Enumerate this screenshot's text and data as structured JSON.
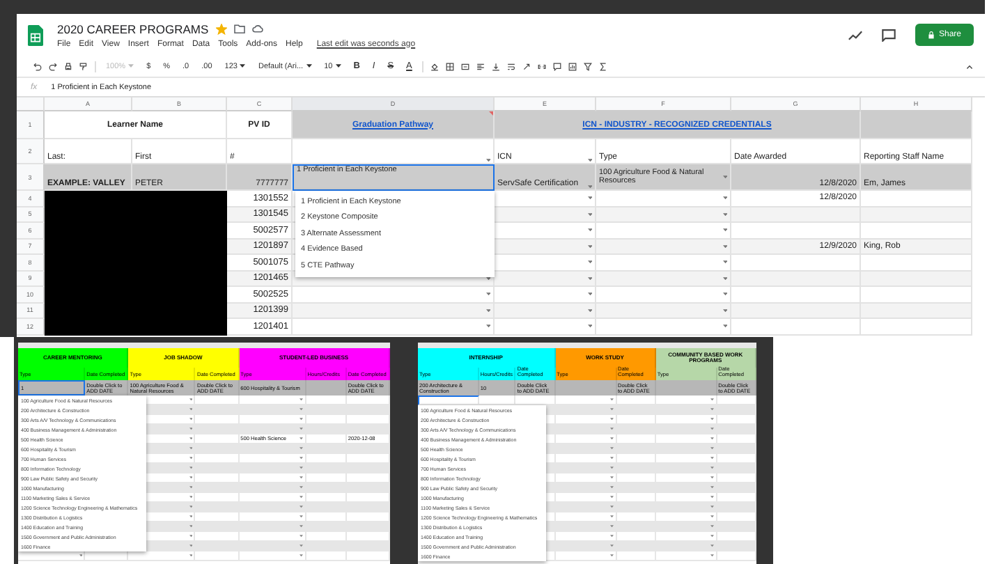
{
  "document": {
    "title": "2020 CAREER PROGRAMS",
    "starred": true,
    "menu": [
      "File",
      "Edit",
      "View",
      "Insert",
      "Format",
      "Data",
      "Tools",
      "Add-ons",
      "Help"
    ],
    "last_edit": "Last edit was seconds ago",
    "share": "Share"
  },
  "toolbar": {
    "items": [
      {
        "kind": "select",
        "label": "100%",
        "disabled": true
      },
      {
        "kind": "button",
        "label": "$",
        "disabled": false
      },
      {
        "kind": "button",
        "label": "%",
        "disabled": false
      },
      {
        "kind": "button",
        "label": ".0",
        "disabled": false
      },
      {
        "kind": "button",
        "label": ".00",
        "disabled": false
      },
      {
        "kind": "select",
        "label": "123",
        "disabled": false
      },
      {
        "kind": "select",
        "label": "Default (Ari...",
        "disabled": false
      },
      {
        "kind": "select",
        "label": "10",
        "disabled": false
      },
      {
        "kind": "bold",
        "label": "B",
        "disabled": false
      },
      {
        "kind": "italic",
        "label": "I",
        "disabled": false
      },
      {
        "kind": "strike",
        "label": "S",
        "disabled": false
      },
      {
        "kind": "textcolor",
        "label": "A",
        "disabled": false
      }
    ]
  },
  "formula_bar": {
    "label": "fx",
    "value": "1 Proficient in Each Keystone"
  },
  "sheet": {
    "columns": [
      "A",
      "B",
      "C",
      "D",
      "E",
      "F",
      "G",
      "H"
    ],
    "heading_row": {
      "number": "1",
      "learner_name": "Learner Name",
      "pv_id": "PV ID",
      "graduation_pathway": "Graduation Pathway",
      "icn": "ICN - INDUSTRY - RECOGNIZED CREDENTIALS"
    },
    "label_row": {
      "number": "2",
      "last": "Last:",
      "first": "First",
      "pv_id": "#",
      "icn": "ICN",
      "type": "Type",
      "date": "Date Awarded",
      "staff": "Reporting Staff Name"
    },
    "example_row": {
      "number": "3",
      "last": "EXAMPLE: VALLEY",
      "first": "PETER",
      "pv_id": "7777777",
      "pathway": "1 Proficient in Each Keystone",
      "icn": "ServSafe Certification",
      "type": "100 Agriculture Food & Natural Resources",
      "date": "12/8/2020",
      "staff": "Em, James"
    },
    "rows": [
      {
        "number": "4",
        "redacted": true,
        "pv_id": "1301552",
        "date": "12/8/2020"
      },
      {
        "number": "5",
        "redacted": true,
        "pv_id": "1301545"
      },
      {
        "number": "6",
        "redacted": true,
        "pv_id": "5002577"
      },
      {
        "number": "7",
        "redacted": true,
        "pv_id": "1201897",
        "date": "12/9/2020",
        "staff": "King, Rob"
      },
      {
        "number": "8",
        "redacted": true,
        "pv_id": "5001075"
      },
      {
        "number": "9",
        "redacted": true,
        "pv_id": "1201465"
      },
      {
        "number": "10",
        "redacted": true,
        "pv_id": "5002525"
      },
      {
        "number": "11",
        "redacted": true,
        "pv_id": "1201399"
      },
      {
        "number": "12",
        "redacted": true,
        "pv_id": "1201401"
      }
    ],
    "dropdown": {
      "options": [
        "1 Proficient in Each Keystone",
        "2 Keystone Composite",
        "3 Alternate Assessment",
        "4 Evidence Based",
        "5 CTE Pathway"
      ]
    }
  },
  "panels": [
    {
      "kind": "cell_editor",
      "groups": [
        {
          "title": "CAREER MENTORING",
          "color": "#00ff00",
          "columns": [
            {
              "label": "Type",
              "kind": "type",
              "example": "1"
            },
            {
              "label": "Date Completed",
              "kind": "date",
              "example": "Double Click to ADD DATE"
            }
          ]
        },
        {
          "title": "JOB SHADOW",
          "color": "#ffff00",
          "columns": [
            {
              "label": "Type",
              "kind": "type",
              "example": "100 Agriculture Food & Natural Resources"
            },
            {
              "label": "Date Completed",
              "kind": "date",
              "example": "Double Click to ADD DATE"
            }
          ]
        },
        {
          "title": "STUDENT-LED BUSINESS",
          "color": "#ff00ff",
          "columns": [
            {
              "label": "Type",
              "kind": "type",
              "example": "600 Hospitality & Tourism"
            },
            {
              "label": "Hours/Credits",
              "kind": "hours"
            },
            {
              "label": "Date Completed",
              "kind": "date",
              "example": "Double Click to ADD DATE"
            }
          ]
        }
      ],
      "body_rows": [
        {
          "shaded": false
        },
        {
          "shaded": true
        },
        {
          "shaded": false
        },
        {
          "shaded": true
        },
        {
          "shaded": false,
          "type_3": "500 Health Science",
          "date_3": "2020-12-08"
        },
        {
          "shaded": true
        },
        {
          "shaded": false
        },
        {
          "shaded": true
        },
        {
          "shaded": false
        },
        {
          "shaded": true
        },
        {
          "shaded": false
        },
        {
          "shaded": true
        },
        {
          "shaded": false
        },
        {
          "shaded": true
        },
        {
          "shaded": false
        },
        {
          "shaded": true
        },
        {
          "shaded": false
        }
      ],
      "options": [
        "100 Agriculture Food & Natural Resources",
        "200 Architecture & Construction",
        "300 Arts A/V Technology & Communications",
        "400 Business Management & Administration",
        "500 Health Science",
        "600 Hospitality & Tourism",
        "700 Human Services",
        "800 Information Technology",
        "900 Law Public Safety and Security",
        "1000 Manufacturing",
        "1100 Marketing Sales & Service",
        "1200 Science Technology Engineering & Mathematics",
        "1300 Distribution & Logistics",
        "1400 Education and Training",
        "1500 Government and Public Administration",
        "1600 Finance"
      ]
    },
    {
      "kind": "row_editor",
      "groups": [
        {
          "title": "INTERNSHIP",
          "color": "#00ffff",
          "columns": [
            {
              "label": "Type",
              "kind": "type",
              "example": "200 Architecture & Construction"
            },
            {
              "label": "Hours/Credits",
              "kind": "hours",
              "example": "10"
            },
            {
              "label": "Date Completed",
              "kind": "date",
              "example": "Double Click to ADD DATE"
            }
          ]
        },
        {
          "title": "WORK STUDY",
          "color": "#ff9900",
          "columns": [
            {
              "label": "Type",
              "kind": "type"
            },
            {
              "label": "Date Completed",
              "kind": "date",
              "example": "Double Click to ADD DATE"
            }
          ]
        },
        {
          "title": "COMMUNITY BASED WORK PROGRAMS",
          "color": "#b6d7a8",
          "columns": [
            {
              "label": "Type",
              "kind": "type"
            },
            {
              "label": "Date Completed",
              "kind": "date",
              "example": "Double Click to ADD DATE"
            }
          ]
        }
      ],
      "body_rows": [
        {
          "shaded": false
        },
        {
          "shaded": true
        },
        {
          "shaded": false
        },
        {
          "shaded": true
        },
        {
          "shaded": false
        },
        {
          "shaded": true
        },
        {
          "shaded": false
        },
        {
          "shaded": true
        },
        {
          "shaded": false
        },
        {
          "shaded": true
        },
        {
          "shaded": false
        },
        {
          "shaded": true
        },
        {
          "shaded": false
        },
        {
          "shaded": true
        },
        {
          "shaded": false
        },
        {
          "shaded": true
        },
        {
          "shaded": false
        }
      ],
      "options": [
        "100 Agriculture Food & Natural Resources",
        "200 Architecture & Construction",
        "300 Arts A/V Technology & Communications",
        "400 Business Management & Administration",
        "500 Health Science",
        "600 Hospitality & Tourism",
        "700 Human Services",
        "800 Information Technology",
        "900 Law Public Safety and Security",
        "1000 Manufacturing",
        "1100 Marketing Sales & Service",
        "1200 Science Technology Engineering & Mathematics",
        "1300 Distribution & Logistics",
        "1400 Education and Training",
        "1500 Government and Public Administration",
        "1600 Finance"
      ]
    }
  ]
}
